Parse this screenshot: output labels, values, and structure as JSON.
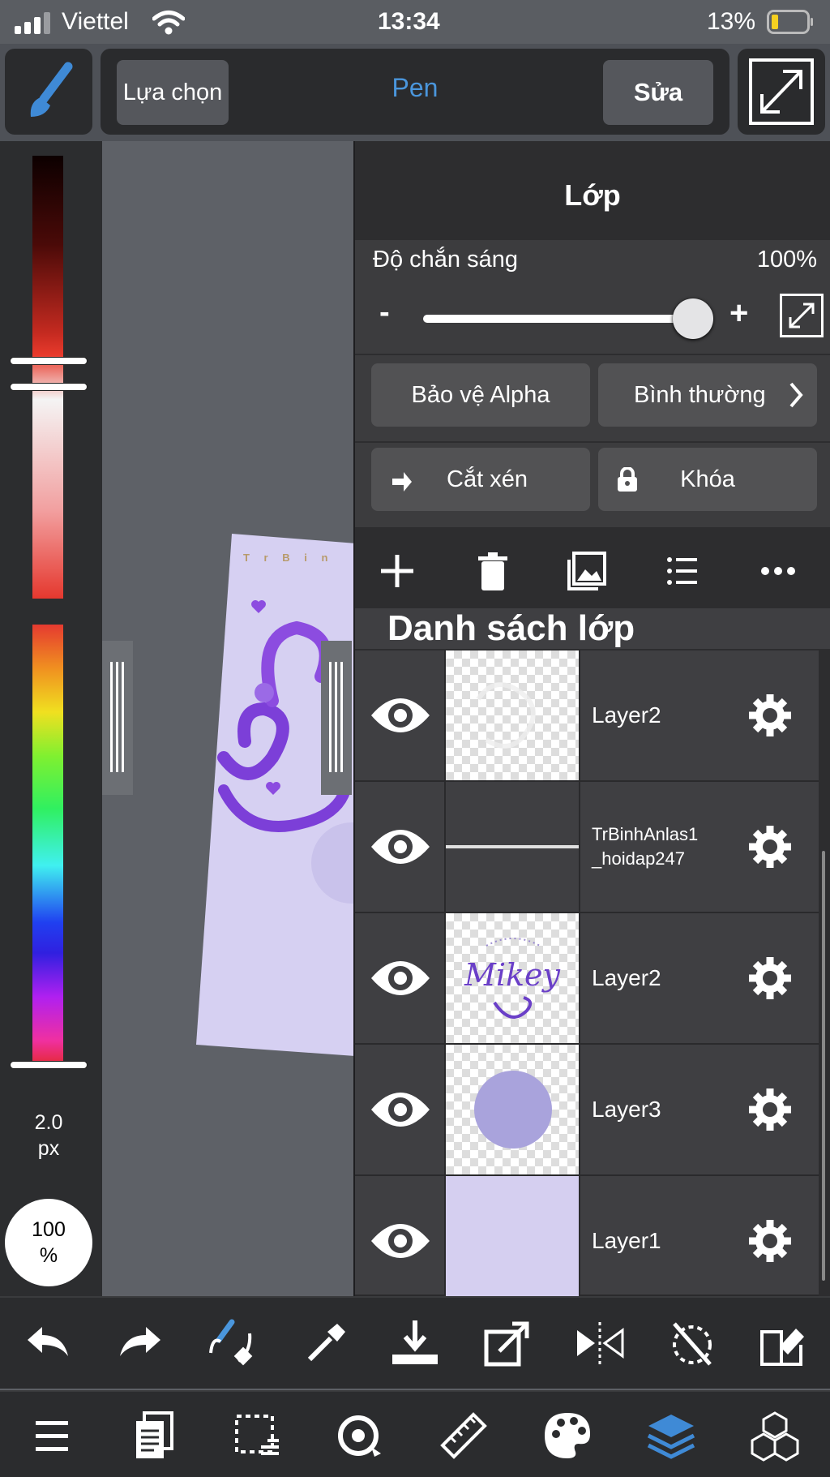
{
  "status_bar": {
    "carrier": "Viettel",
    "time": "13:34",
    "battery": "13%"
  },
  "toolbar": {
    "select_label": "Lựa chọn",
    "tool_name": "Pen",
    "edit_label": "Sửa"
  },
  "left_panel": {
    "brush_size": "2.0",
    "brush_unit": "px",
    "opacity_value": "100",
    "opacity_unit": "%"
  },
  "layer_panel": {
    "title": "Lớp",
    "opacity_label": "Độ chắn sáng",
    "opacity_value": "100%",
    "opacity_minus": "-",
    "opacity_plus": "+",
    "alpha_protect_label": "Bảo vệ Alpha",
    "blend_mode_label": "Bình thường",
    "clipping_label": "Cắt xén",
    "lock_label": "Khóa",
    "list_title": "Danh sách lớp",
    "layers": [
      {
        "name": "Layer2"
      },
      {
        "name_line1": "TrBinhAnlas1",
        "name_line2": "_hoidap247"
      },
      {
        "name": "Layer2",
        "thumb_text": "Mikey"
      },
      {
        "name": "Layer3"
      },
      {
        "name": "Layer1"
      }
    ]
  },
  "canvas": {
    "header_text": "T r B i n"
  },
  "colors": {
    "accent": "#4a96dc",
    "panel": "#2d2d2f",
    "row": "#3f3f42",
    "layer1_fill": "#d5cff0",
    "layer3_circle": "#a9a3dc"
  },
  "icons": {
    "bottom_row1": [
      "undo-icon",
      "redo-icon",
      "brush-transform-icon",
      "eyedropper-icon",
      "save-icon",
      "export-icon",
      "flip-icon",
      "rotate-reset-icon",
      "eraser-icon"
    ],
    "bottom_row2": [
      "menu-icon",
      "pages-icon",
      "selection-icon",
      "snap-icon",
      "ruler-icon",
      "palette-icon",
      "layers-icon",
      "materials-icon"
    ]
  }
}
